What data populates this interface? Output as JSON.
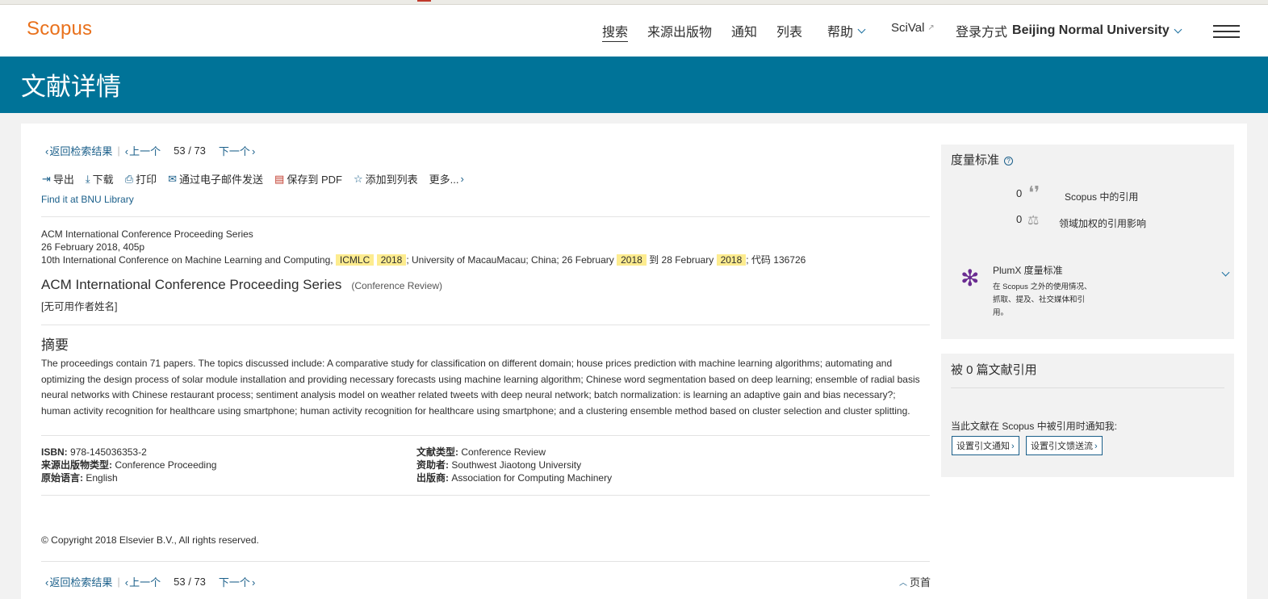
{
  "header": {
    "logo": "Scopus",
    "nav": {
      "search": "搜索",
      "sources": "来源出版物",
      "alerts": "通知",
      "lists": "列表",
      "help": "帮助",
      "scival": "SciVal",
      "login_prefix": "登录方式",
      "institution": "Beijing Normal University"
    }
  },
  "banner": {
    "title": "文献详情"
  },
  "navigation": {
    "back": "返回检索结果",
    "prev": "上一个",
    "current": "53",
    "slash": "/",
    "total": "73",
    "next": "下一个",
    "top": "页首"
  },
  "toolbar": {
    "export": "导出",
    "download": "下载",
    "print": "打印",
    "email": "通过电子邮件发送",
    "save_pdf": "保存到 PDF",
    "add_list": "添加到列表",
    "more": "更多..."
  },
  "library_link": "Find it at BNU Library",
  "source": {
    "series": "ACM International Conference Proceeding Series",
    "date_pages": "26 February 2018, 405p",
    "conf_prefix": "10th International Conference on Machine Learning and Computing,",
    "hl_acronym": "ICMLC",
    "hl_year": "2018",
    "conf_location": "; University of MacauMacau; China; 26 February",
    "to": "到",
    "end_date": "28 February",
    "code": "; 代码 136726"
  },
  "document": {
    "title": "ACM International Conference Proceeding Series",
    "type": "(Conference Review)",
    "authors": "[无可用作者姓名]"
  },
  "abstract": {
    "heading": "摘要",
    "text": "The proceedings contain 71 papers. The topics discussed include: A comparative study for classification on different domain; house prices prediction with machine learning algorithms; automating and optimizing the design process of solar module installation and providing necessary forecasts using machine learning algorithm; Chinese word segmentation based on deep learning; ensemble of radial basis neural networks with Chinese restaurant process; sentiment analysis model on weather related tweets with deep neural network; batch normalization: is learning an adaptive gain and bias necessary?; human activity recognition for healthcare using smartphone; human activity recognition for healthcare using smartphone; and a clustering ensemble method based on cluster selection and cluster splitting."
  },
  "metadata": {
    "isbn_label": "ISBN:",
    "isbn": "978-145036353-2",
    "source_type_label": "来源出版物类型:",
    "source_type": "Conference Proceeding",
    "language_label": "原始语言:",
    "language": "English",
    "doc_type_label": "文献类型:",
    "doc_type": "Conference Review",
    "sponsor_label": "资助者:",
    "sponsor": "Southwest Jiaotong University",
    "publisher_label": "出版商:",
    "publisher": "Association for Computing Machinery"
  },
  "copyright": "© Copyright 2018 Elsevier B.V., All rights reserved.",
  "metrics": {
    "heading": "度量标准",
    "help": "?",
    "citations_value": "0",
    "citations_label": "Scopus 中的引用",
    "fwci_value": "0",
    "fwci_label": "领域加权的引用影响",
    "plumx_title": "PlumX 度量标准",
    "plumx_desc_1": "在 Scopus 之外的使用情况、",
    "plumx_desc_2": "抓取、提及、社交媒体和引",
    "plumx_desc_3": "用。"
  },
  "cited_by": {
    "heading": "被 0 篇文献引用",
    "notify_text": "当此文献在 Scopus 中被引用时通知我:",
    "alert_button": "设置引文通知",
    "feed_button": "设置引文馈送流"
  },
  "colors": {
    "brand_orange": "#e9711c",
    "banner_blue": "#007398",
    "link_blue": "#1a5f8a",
    "highlight": "#fdec8f",
    "plumx_purple": "#6a2c91"
  }
}
